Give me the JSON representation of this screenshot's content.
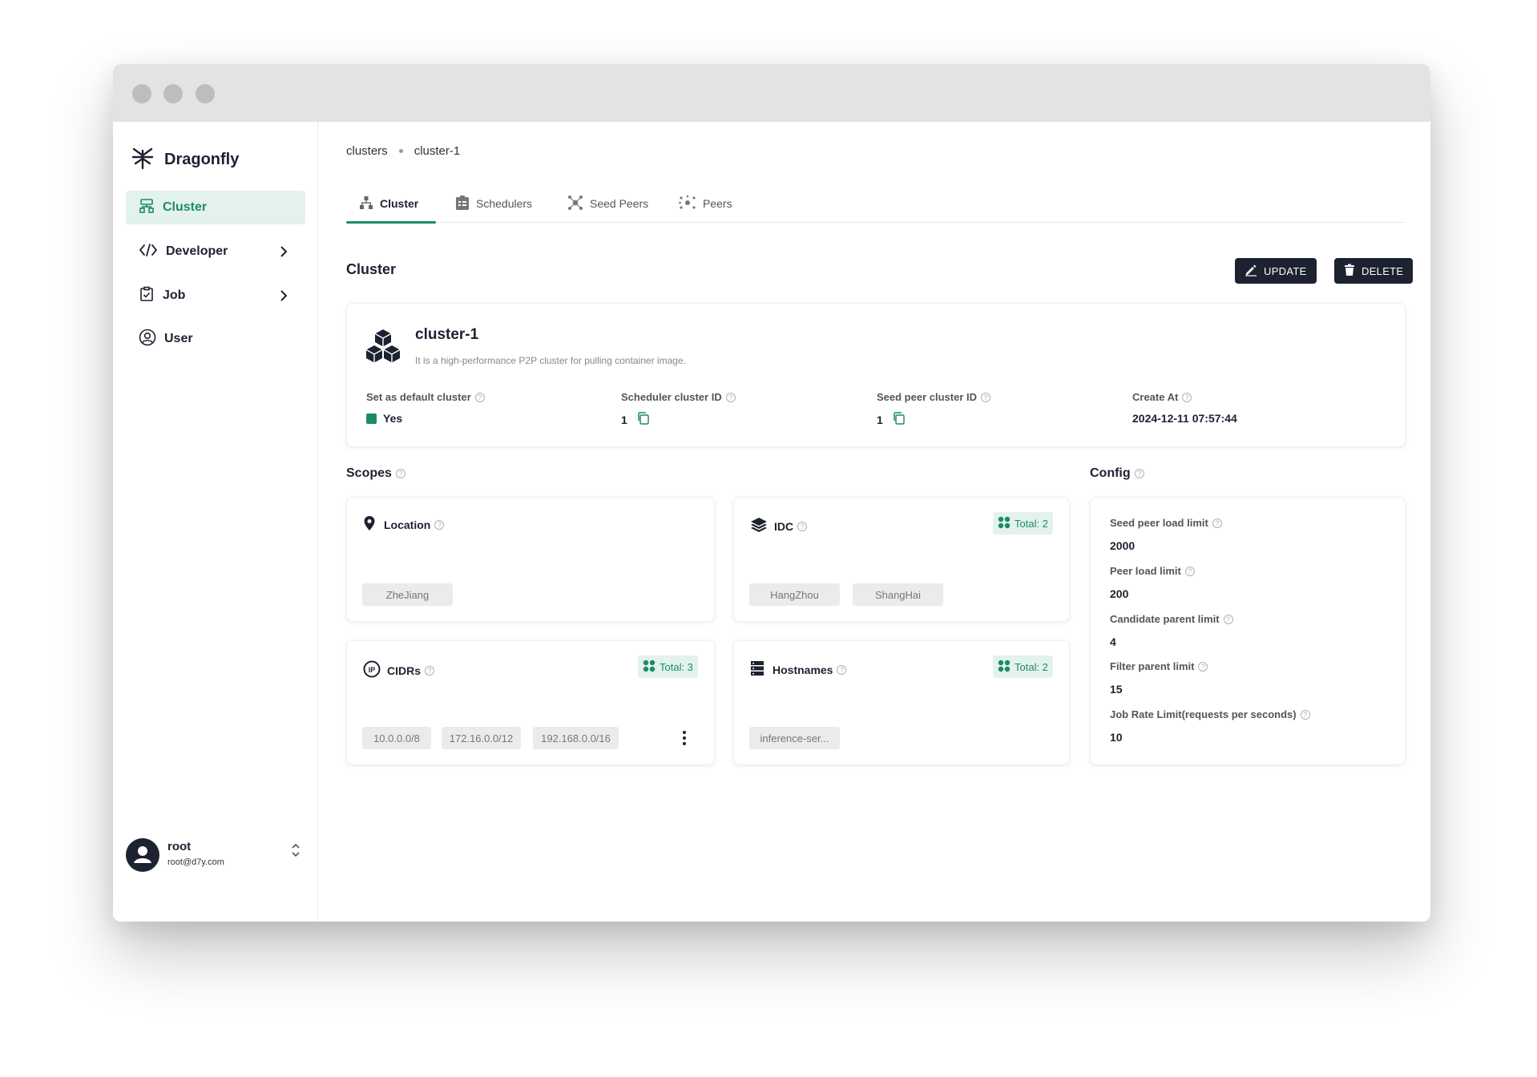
{
  "app": {
    "name": "Dragonfly"
  },
  "sidebar": {
    "items": [
      {
        "label": "Cluster",
        "icon": "cluster-icon",
        "active": true
      },
      {
        "label": "Developer",
        "icon": "code-icon",
        "has_submenu": true
      },
      {
        "label": "Job",
        "icon": "clipboard-icon",
        "has_submenu": true
      },
      {
        "label": "User",
        "icon": "user-circle-icon"
      }
    ]
  },
  "user": {
    "name": "root",
    "email": "root@d7y.com"
  },
  "breadcrumb": {
    "parent": "clusters",
    "current": "cluster-1"
  },
  "tabs": [
    {
      "label": "Cluster",
      "icon": "cluster-tree-icon",
      "active": true
    },
    {
      "label": "Schedulers",
      "icon": "scheduler-icon"
    },
    {
      "label": "Seed Peers",
      "icon": "seed-peers-icon"
    },
    {
      "label": "Peers",
      "icon": "peers-icon"
    }
  ],
  "page": {
    "title": "Cluster",
    "update_label": "UPDATE",
    "delete_label": "DELETE"
  },
  "cluster": {
    "name": "cluster-1",
    "description": "It is a high-performance P2P cluster for pulling container image.",
    "default_label": "Set as default cluster",
    "default_value": "Yes",
    "scheduler_label": "Scheduler cluster ID",
    "scheduler_value": "1",
    "seed_label": "Seed peer cluster ID",
    "seed_value": "1",
    "created_label": "Create At",
    "created_value": "2024-12-11 07:57:44"
  },
  "scopes": {
    "title": "Scopes",
    "location": {
      "title": "Location",
      "values": [
        "ZheJiang"
      ]
    },
    "idc": {
      "title": "IDC",
      "total": "Total: 2",
      "values": [
        "HangZhou",
        "ShangHai"
      ]
    },
    "cidrs": {
      "title": "CIDRs",
      "total": "Total: 3",
      "values": [
        "10.0.0.0/8",
        "172.16.0.0/12",
        "192.168.0.0/16"
      ]
    },
    "hostnames": {
      "title": "Hostnames",
      "total": "Total: 2",
      "values": [
        "inference-ser..."
      ]
    }
  },
  "config": {
    "title": "Config",
    "items": [
      {
        "label": "Seed peer load limit",
        "value": "2000"
      },
      {
        "label": "Peer load limit",
        "value": "200"
      },
      {
        "label": "Candidate parent limit",
        "value": "4"
      },
      {
        "label": "Filter parent limit",
        "value": "15"
      },
      {
        "label": "Job Rate Limit(requests per seconds)",
        "value": "10"
      }
    ]
  },
  "colors": {
    "accent": "#1d8a6b",
    "dark": "#1c2230",
    "active_bg": "#e3f3ec"
  }
}
